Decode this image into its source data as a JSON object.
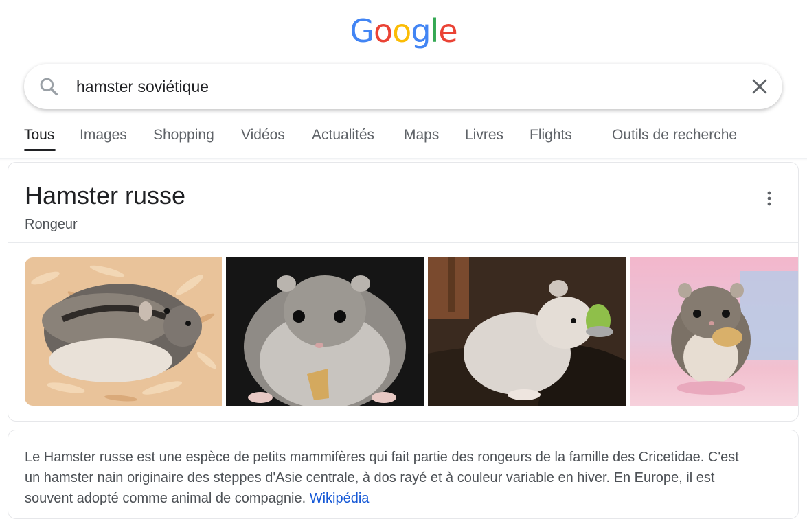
{
  "logo": {
    "letters": [
      "G",
      "o",
      "o",
      "g",
      "l",
      "e"
    ],
    "colors": [
      "#4285F4",
      "#EA4335",
      "#FBBC05",
      "#4285F4",
      "#34A853",
      "#EA4335"
    ]
  },
  "search": {
    "query": "hamster soviétique"
  },
  "tabs": [
    {
      "label": "Tous",
      "active": true
    },
    {
      "label": "Images"
    },
    {
      "label": "Shopping"
    },
    {
      "label": "Vidéos"
    },
    {
      "label": "Actualités"
    },
    {
      "label": "Maps"
    },
    {
      "label": "Livres"
    },
    {
      "label": "Flights"
    },
    {
      "label": "Outils de recherche"
    }
  ],
  "knowledge_panel": {
    "title": "Hamster russe",
    "subtitle": "Rongeur",
    "images": [
      "hamster-photo-1",
      "hamster-photo-2",
      "hamster-photo-3",
      "hamster-photo-4"
    ],
    "description_lines": [
      "Le Hamster russe est une espèce de petits mammifères qui fait partie des rongeurs de la famille des Cricetidae. C'est",
      "un hamster nain originaire des steppes d'Asie centrale, à dos rayé et à couleur variable en hiver. En Europe, il est",
      "souvent adopté comme animal de compagnie."
    ],
    "source_link": "Wikipédia"
  },
  "icons": {
    "search": "search-icon",
    "clear": "close-icon",
    "more": "more-vert-icon"
  },
  "colors": {
    "link": "#1558d6",
    "text": "#202124",
    "secondary": "#5f6368"
  }
}
